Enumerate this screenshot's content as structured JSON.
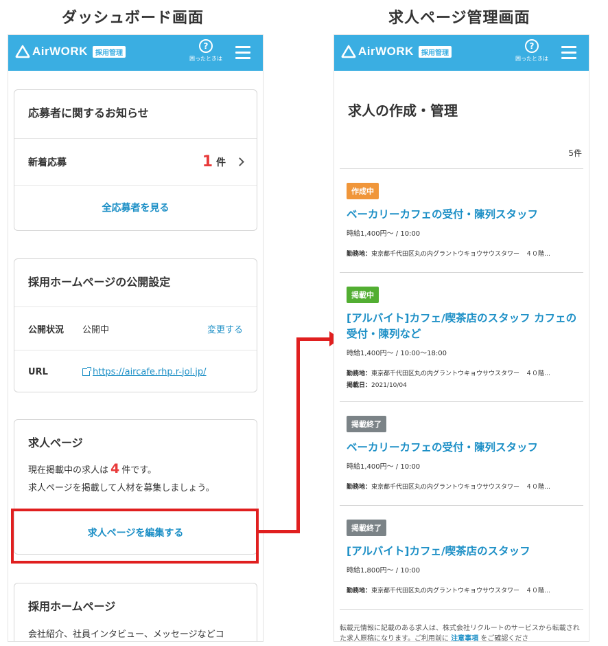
{
  "captions": {
    "left": "ダッシュボード画面",
    "right": "求人ページ管理画面"
  },
  "header": {
    "brand": "AirWORK",
    "badge": "採用管理",
    "help_label": "困ったときは",
    "help_symbol": "?"
  },
  "dashboard": {
    "notice_card": {
      "title": "応募者に関するお知らせ",
      "new_label": "新着応募",
      "new_count": "1",
      "unit": "件",
      "view_all": "全応募者を見る"
    },
    "publish_card": {
      "title": "採用ホームページの公開設定",
      "status_label": "公開状況",
      "status_value": "公開中",
      "change_link": "変更する",
      "url_label": "URL",
      "url_value": "https://aircafe.rhp.r-jol.jp/"
    },
    "jobs_card": {
      "title": "求人ページ",
      "text_before": "現在掲載中の求人は",
      "count": "4",
      "text_after": "件です。",
      "text_line2": "求人ページを掲載して人材を募集しましょう。",
      "edit_button": "求人ページを編集する"
    },
    "homepage_card": {
      "title": "採用ホームページ",
      "text": "会社紹介、社員インタビュー、メッセージなどコ"
    }
  },
  "manage": {
    "title": "求人の作成・管理",
    "count": "5件",
    "jobs": [
      {
        "status": "作成中",
        "status_color": "#f0963a",
        "title": "ベーカリーカフェの受付・陳列スタッフ",
        "wage": "時給1,400円～ / 10:00",
        "loc_label": "勤務地：",
        "loc_value": "東京都千代田区丸の内グラントウキョウサウスタワー　４０階…"
      },
      {
        "status": "掲載中",
        "status_color": "#52ae32",
        "title": "[アルバイト]カフェ/喫茶店のスタッフ カフェの受付・陳列など",
        "wage": "時給1,400円～ / 10:00～18:00",
        "loc_label": "勤務地：",
        "loc_value": "東京都千代田区丸の内グラントウキョウサウスタワー　４０階…",
        "date_label": "掲載日：",
        "date_value": "2021/10/04"
      },
      {
        "status": "掲載終了",
        "status_color": "#7b8387",
        "title": "ベーカリーカフェの受付・陳列スタッフ",
        "wage": "時給1,400円～ / 10:00",
        "loc_label": "勤務地：",
        "loc_value": "東京都千代田区丸の内グラントウキョウサウスタワー　４０階…"
      },
      {
        "status": "掲載終了",
        "status_color": "#7b8387",
        "title": "[アルバイト]カフェ/喫茶店のスタッフ",
        "wage": "時給1,800円～ / 10:00",
        "loc_label": "勤務地：",
        "loc_value": "東京都千代田区丸の内グラントウキョウサウスタワー　４０階…"
      }
    ],
    "footer": {
      "text_before": "転載元情報に記載のある求人は、株式会社リクルートのサービスから転載された求人原稿になります。ご利用前に",
      "link": "注意事項",
      "text_after": "をご確認くださ"
    }
  },
  "colors": {
    "header": "#3aaee2",
    "link": "#1c8fc6",
    "count": "#e83a3a",
    "highlight": "#e01f1f"
  }
}
